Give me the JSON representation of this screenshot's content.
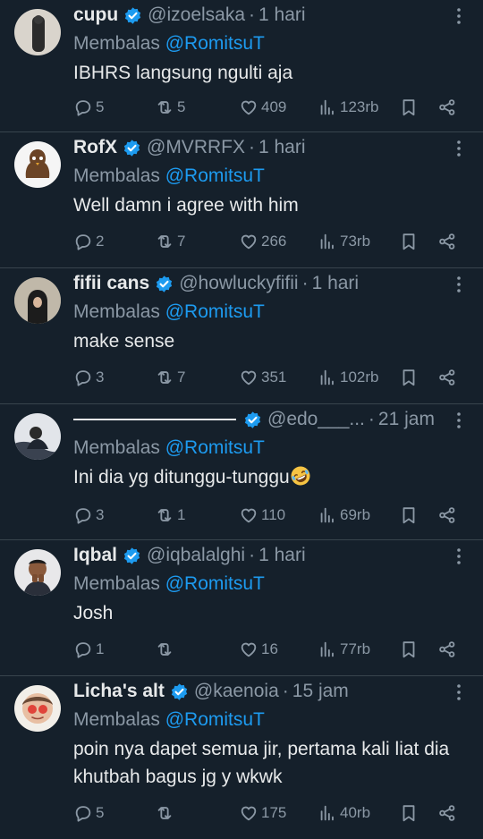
{
  "tweets": [
    {
      "name": "cupu",
      "handle": "@izoelsaka",
      "dot": "·",
      "time": "1 hari",
      "reply_prefix": "Membalas",
      "reply_to": "@RomitsuT",
      "text": "IBHRS langsung ngulti aja",
      "replies": "5",
      "retweets": "5",
      "likes": "409",
      "views": "123rb"
    },
    {
      "name": "RofX",
      "handle": "@MVRRFX",
      "dot": "·",
      "time": "1 hari",
      "reply_prefix": "Membalas",
      "reply_to": "@RomitsuT",
      "text": "Well damn i agree with him",
      "replies": "2",
      "retweets": "7",
      "likes": "266",
      "views": "73rb"
    },
    {
      "name": "fifii cans",
      "handle": "@howluckyfifii",
      "dot": "·",
      "time": "1 hari",
      "reply_prefix": "Membalas",
      "reply_to": "@RomitsuT",
      "text": "make sense",
      "replies": "3",
      "retweets": "7",
      "likes": "351",
      "views": "102rb"
    },
    {
      "name": "",
      "handle": "@edo___...",
      "dot": "·",
      "time": "21 jam",
      "reply_prefix": "Membalas",
      "reply_to": "@RomitsuT",
      "text": "Ini dia yg ditunggu-tunggu",
      "replies": "3",
      "retweets": "1",
      "likes": "110",
      "views": "69rb"
    },
    {
      "name": "Iqbal",
      "handle": "@iqbalalghi",
      "dot": "·",
      "time": "1 hari",
      "reply_prefix": "Membalas",
      "reply_to": "@RomitsuT",
      "text": "Josh",
      "replies": "1",
      "retweets": "",
      "likes": "16",
      "views": "77rb"
    },
    {
      "name": "Licha's alt",
      "handle": "@kaenoia",
      "dot": "·",
      "time": "15 jam",
      "reply_prefix": "Membalas",
      "reply_to": "@RomitsuT",
      "text": "poin nya dapet semua jir, pertama kali liat dia khutbah bagus jg y wkwk",
      "replies": "5",
      "retweets": "",
      "likes": "175",
      "views": "40rb"
    }
  ],
  "colors": {
    "background": "#15202b",
    "text": "#e7e9ea",
    "secondary": "#8b98a5",
    "accent": "#1d9bf0",
    "divider": "#38444d"
  },
  "icons": {
    "verified": "verified-badge-icon",
    "more": "more-icon",
    "reply": "reply-icon",
    "retweet": "retweet-icon",
    "like": "like-icon",
    "views": "views-icon",
    "bookmark": "bookmark-icon",
    "share": "share-icon",
    "emoji": "rolling-laughing-emoji"
  }
}
